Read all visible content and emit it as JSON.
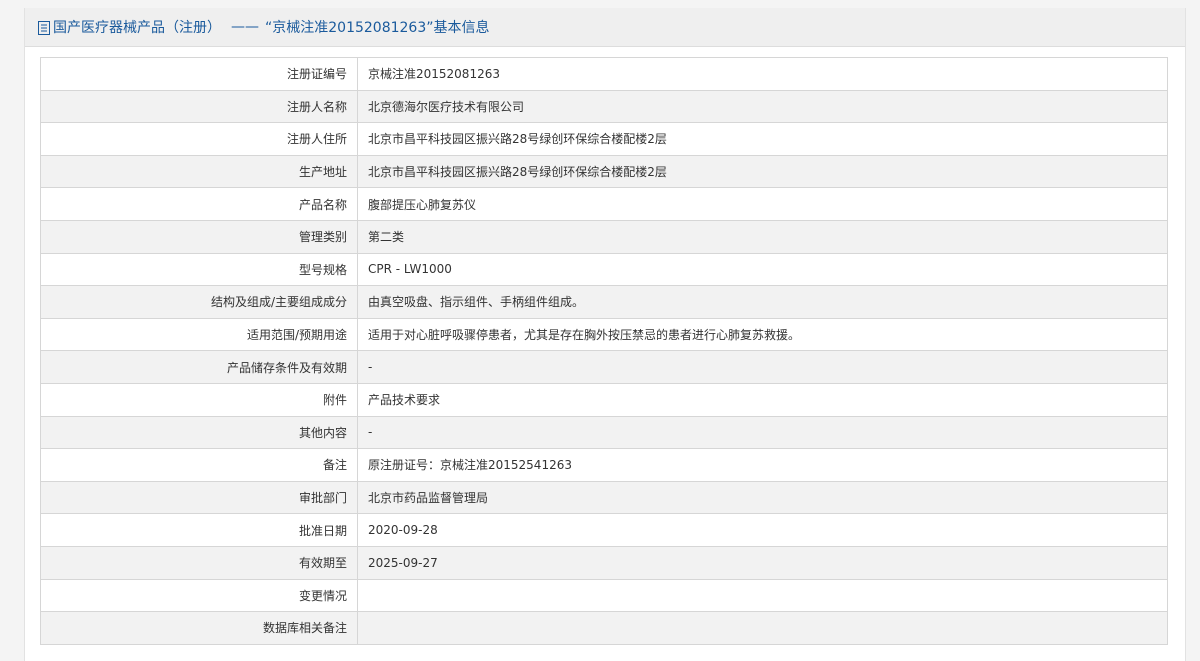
{
  "header": {
    "prefix": "国产医疗器械产品（注册）",
    "separator": "——",
    "title": "“京械注准20152081263”基本信息"
  },
  "rows": [
    {
      "label": "注册证编号",
      "value": "京械注准20152081263"
    },
    {
      "label": "注册人名称",
      "value": "北京德海尔医疗技术有限公司"
    },
    {
      "label": "注册人住所",
      "value": "北京市昌平科技园区振兴路28号绿创环保综合楼配楼2层"
    },
    {
      "label": "生产地址",
      "value": "北京市昌平科技园区振兴路28号绿创环保综合楼配楼2层"
    },
    {
      "label": "产品名称",
      "value": "腹部提压心肺复苏仪"
    },
    {
      "label": "管理类别",
      "value": "第二类"
    },
    {
      "label": "型号规格",
      "value": "CPR - LW1000"
    },
    {
      "label": "结构及组成/主要组成成分",
      "value": "由真空吸盘、指示组件、手柄组件组成。"
    },
    {
      "label": "适用范围/预期用途",
      "value": "适用于对心脏呼吸骤停患者，尤其是存在胸外按压禁忌的患者进行心肺复苏救援。"
    },
    {
      "label": "产品储存条件及有效期",
      "value": "-"
    },
    {
      "label": "附件",
      "value": "产品技术要求"
    },
    {
      "label": "其他内容",
      "value": "-"
    },
    {
      "label": "备注",
      "value": "原注册证号：京械注准20152541263"
    },
    {
      "label": "审批部门",
      "value": "北京市药品监督管理局"
    },
    {
      "label": "批准日期",
      "value": "2020-09-28"
    },
    {
      "label": "有效期至",
      "value": "2025-09-27"
    },
    {
      "label": "变更情况",
      "value": ""
    },
    {
      "label": "数据库相关备注",
      "value": ""
    }
  ]
}
